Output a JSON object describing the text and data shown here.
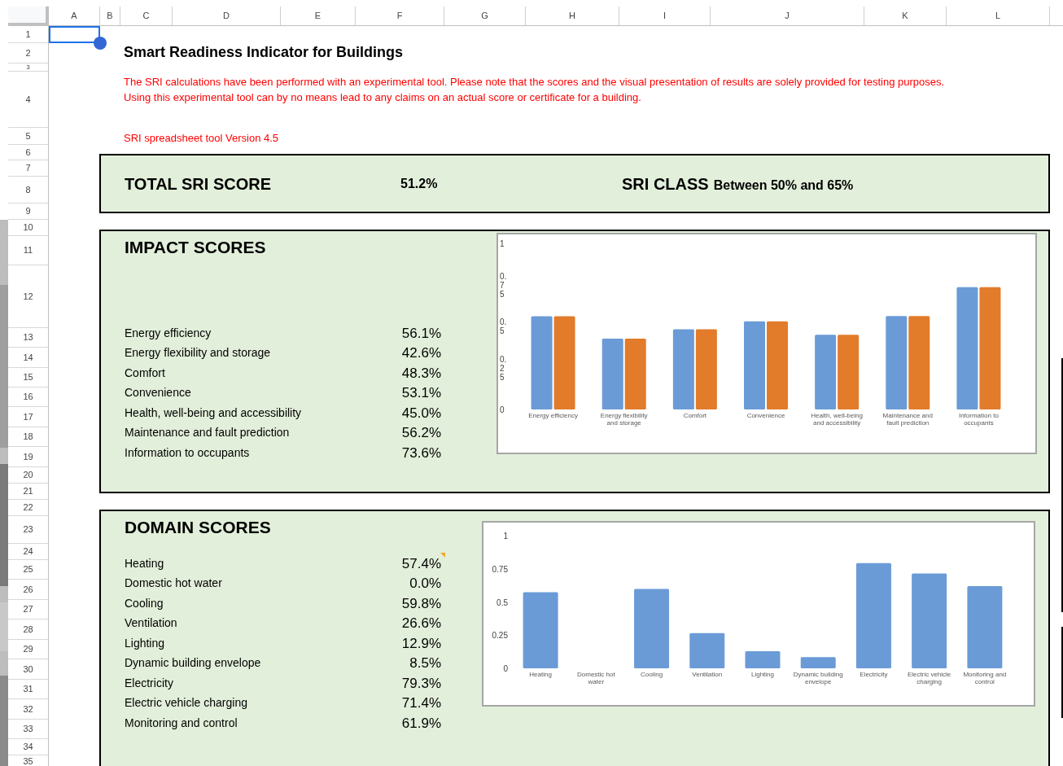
{
  "sheet": {
    "columns": [
      "A",
      "B",
      "C",
      "D",
      "E",
      "F",
      "G",
      "H",
      "I",
      "J",
      "K",
      "L"
    ],
    "rows": [
      "1",
      "2",
      "3",
      "4",
      "5",
      "6",
      "7",
      "8",
      "9",
      "10",
      "11",
      "12",
      "13",
      "14",
      "15",
      "16",
      "17",
      "18",
      "19",
      "20",
      "21",
      "22",
      "23",
      "24",
      "25",
      "26",
      "27",
      "28",
      "29",
      "30",
      "31",
      "32",
      "33",
      "34",
      "35"
    ]
  },
  "title": "Smart Readiness Indicator for Buildings",
  "disclaimer": [
    "The SRI calculations have been performed with an experimental tool. Please note that the scores and the visual presentation of results are solely provided for testing purposes.",
    "Using this experimental tool can by no means lead to any claims on an actual score or certificate for a building."
  ],
  "version": "SRI spreadsheet tool Version 4.5",
  "total": {
    "label": "TOTAL SRI SCORE",
    "value": "51.2%",
    "class_label": "SRI CLASS",
    "class_value": "Between 50% and 65%"
  },
  "impact": {
    "heading": "IMPACT SCORES",
    "items": [
      {
        "label": "Energy efficiency",
        "value": "56.1%",
        "has_comment": false
      },
      {
        "label": "Energy flexibility and storage",
        "value": "42.6%",
        "has_comment": false
      },
      {
        "label": "Comfort",
        "value": "48.3%",
        "has_comment": false
      },
      {
        "label": "Convenience",
        "value": "53.1%",
        "has_comment": false
      },
      {
        "label": "Health, well-being and accessibility",
        "value": "45.0%",
        "has_comment": false
      },
      {
        "label": "Maintenance and fault prediction",
        "value": "56.2%",
        "has_comment": false
      },
      {
        "label": "Information to occupants",
        "value": "73.6%",
        "has_comment": false
      }
    ],
    "chart_data": {
      "type": "bar",
      "categories": [
        "Energy efficiency",
        "Energy flexibility and storage",
        "Comfort",
        "Convenience",
        "Health, well-being and accessibility",
        "Maintenance and fault prediction",
        "Information to occupants"
      ],
      "series": [
        {
          "color": "#6a9bd6",
          "values": [
            0.561,
            0.426,
            0.483,
            0.531,
            0.45,
            0.562,
            0.736
          ]
        },
        {
          "color": "#e27b2a",
          "values": [
            0.561,
            0.426,
            0.483,
            0.531,
            0.45,
            0.562,
            0.736
          ]
        }
      ],
      "ylim": [
        0,
        1
      ],
      "yticks": [
        {
          "value": 0,
          "label": "0"
        },
        {
          "value": 0.25,
          "label": "0.25"
        },
        {
          "value": 0.5,
          "label": "0.5"
        },
        {
          "value": 0.75,
          "label": "0.75"
        },
        {
          "value": 1,
          "label": "1"
        }
      ]
    }
  },
  "domain": {
    "heading": "DOMAIN SCORES",
    "items": [
      {
        "label": "Heating",
        "value": "57.4%",
        "has_comment": true
      },
      {
        "label": "Domestic hot water",
        "value": "0.0%",
        "has_comment": false
      },
      {
        "label": "Cooling",
        "value": "59.8%",
        "has_comment": false
      },
      {
        "label": "Ventilation",
        "value": "26.6%",
        "has_comment": false
      },
      {
        "label": "Lighting",
        "value": "12.9%",
        "has_comment": false
      },
      {
        "label": "Dynamic building envelope",
        "value": "8.5%",
        "has_comment": false
      },
      {
        "label": "Electricity",
        "value": "79.3%",
        "has_comment": false
      },
      {
        "label": "Electric vehicle charging",
        "value": "71.4%",
        "has_comment": false
      },
      {
        "label": "Monitoring and control",
        "value": "61.9%",
        "has_comment": false
      }
    ],
    "chart_data": {
      "type": "bar",
      "categories": [
        "Heating",
        "Domestic hot water",
        "Cooling",
        "Ventilation",
        "Lighting",
        "Dynamic building envelope",
        "Electricity",
        "Electric vehicle charging",
        "Monitoring and control"
      ],
      "series": [
        {
          "color": "#6a9bd6",
          "values": [
            0.574,
            0,
            0.598,
            0.266,
            0.129,
            0.085,
            0.793,
            0.714,
            0.619
          ]
        }
      ],
      "ylim": [
        0,
        1
      ],
      "yticks": [
        0,
        0.25,
        0.5,
        0.75,
        1
      ]
    }
  }
}
